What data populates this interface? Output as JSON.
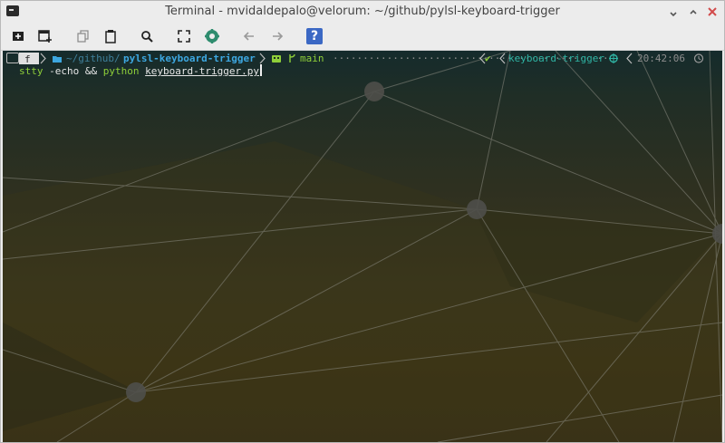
{
  "window": {
    "title": "Terminal - mvidaldepalo@velorum: ~/github/pylsl-keyboard-trigger",
    "controls": [
      "minimize",
      "maximize",
      "close"
    ]
  },
  "toolbar": {
    "items": [
      {
        "name": "new-tab-icon"
      },
      {
        "name": "new-window-icon"
      },
      {
        "name": "copy-icon"
      },
      {
        "name": "paste-icon"
      },
      {
        "name": "search-icon"
      },
      {
        "name": "fullscreen-icon"
      },
      {
        "name": "preferences-icon"
      },
      {
        "name": "back-arrow-icon"
      },
      {
        "name": "forward-arrow-icon"
      },
      {
        "name": "help-icon",
        "label": "?"
      }
    ]
  },
  "prompt": {
    "os_icon": "fedora-icon",
    "folder_icon": "folder-icon",
    "path_dim": "~/github/",
    "path_bold": "pylsl-keyboard-trigger",
    "git_icon": "git-icon",
    "branch_icon": "branch-icon",
    "branch": "main",
    "dots": "··············································",
    "status_check": "✔",
    "venv": "keyboard-trigger",
    "python_icon": "python-icon",
    "time": "20:42:06",
    "clock_icon": "clock-icon"
  },
  "command": {
    "part1": "stty",
    "part2": " -echo && ",
    "part3": "python",
    "part4": " ",
    "part5": "keyboard-trigger.py"
  },
  "colors": {
    "accent_blue": "#3da7e0",
    "prompt_green": "#8fcf39",
    "prompt_teal": "#2fb3a3"
  }
}
